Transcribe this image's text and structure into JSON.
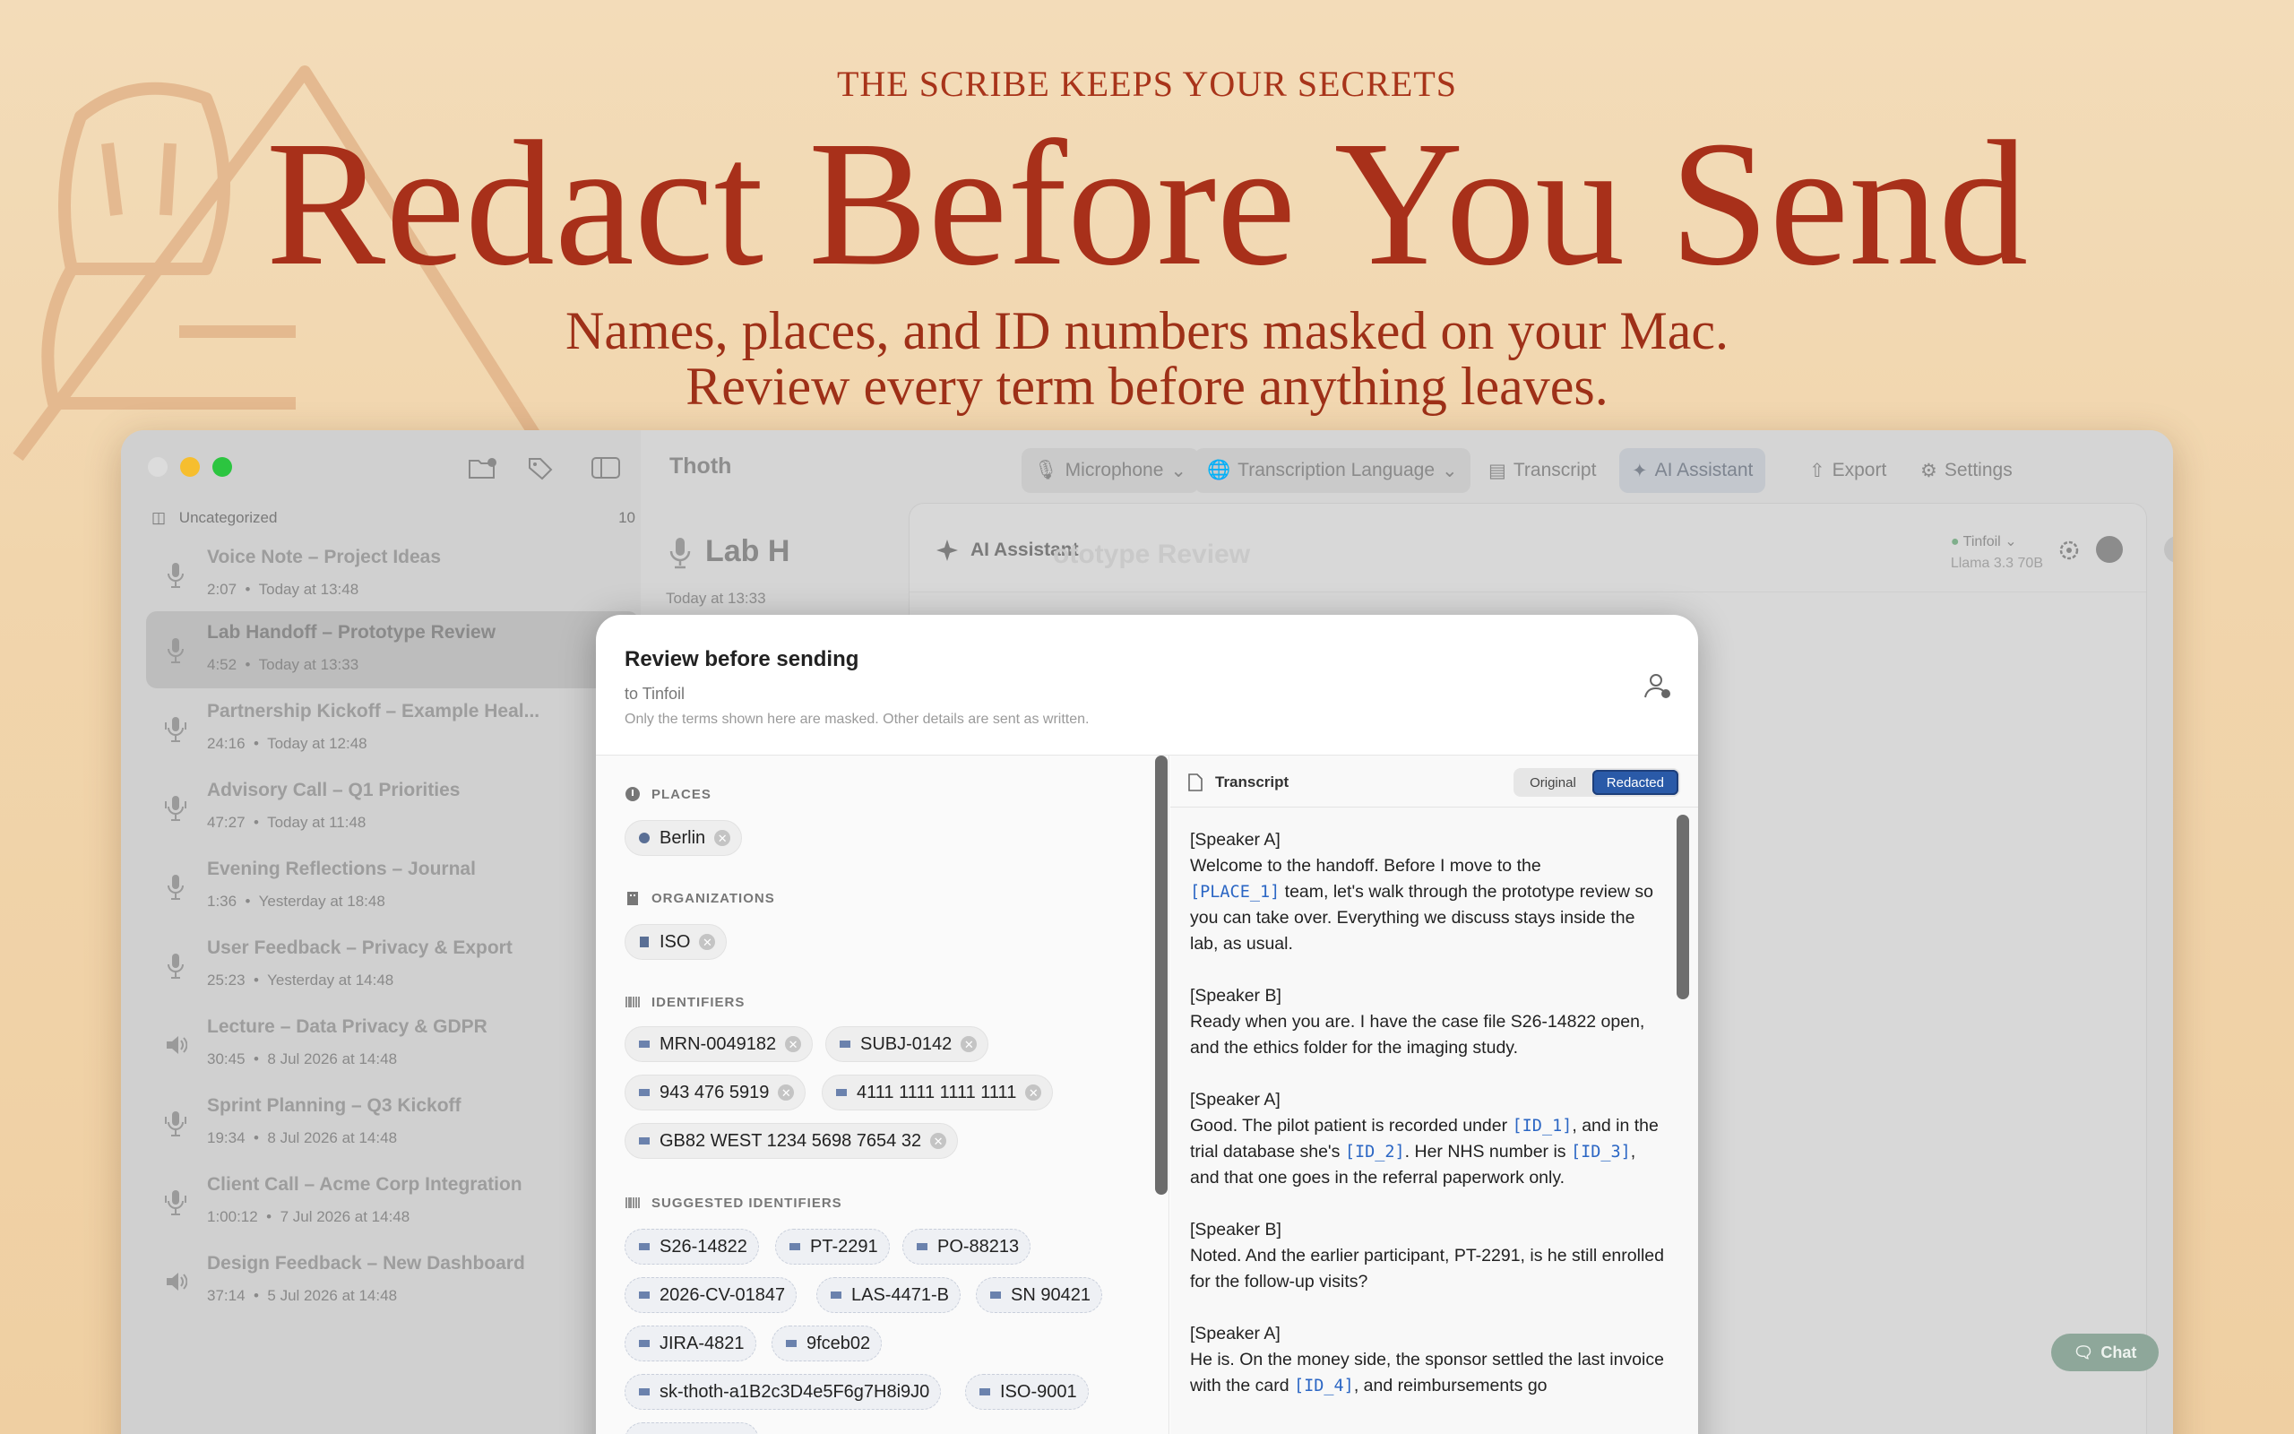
{
  "hero": {
    "tagline": "THE SCRIBE KEEPS YOUR SECRETS",
    "headline": "Redact Before You Send",
    "subline1": "Names, places, and ID numbers masked on your Mac.",
    "subline2": "Review every term before anything leaves."
  },
  "app": {
    "title": "Thoth",
    "toolbar": {
      "microphone": "Microphone",
      "language": "Transcription Language",
      "transcript": "Transcript",
      "ai_assistant": "AI Assistant",
      "export": "Export",
      "settings": "Settings"
    }
  },
  "sidebar": {
    "group": "Uncategorized",
    "group_count": "10",
    "items": [
      {
        "title": "Voice Note – Project Ideas",
        "duration": "2:07",
        "when": "Today at 13:48",
        "icon": "mic-icon"
      },
      {
        "title": "Lab Handoff – Prototype Review",
        "duration": "4:52",
        "when": "Today at 13:33",
        "icon": "mic-icon"
      },
      {
        "title": "Partnership Kickoff – Example Heal...",
        "duration": "24:16",
        "when": "Today at 12:48",
        "icon": "mic-waves-icon"
      },
      {
        "title": "Advisory Call – Q1 Priorities",
        "duration": "47:27",
        "when": "Today at 11:48",
        "icon": "mic-waves-icon"
      },
      {
        "title": "Evening Reflections – Journal",
        "duration": "1:36",
        "when": "Yesterday at 18:48",
        "icon": "mic-icon"
      },
      {
        "title": "User Feedback – Privacy & Export",
        "duration": "25:23",
        "when": "Yesterday at 14:48",
        "icon": "mic-icon"
      },
      {
        "title": "Lecture – Data Privacy & GDPR",
        "duration": "30:45",
        "when": "8 Jul 2026 at 14:48",
        "icon": "speaker-icon"
      },
      {
        "title": "Sprint Planning – Q3 Kickoff",
        "duration": "19:34",
        "when": "8 Jul 2026 at 14:48",
        "icon": "mic-waves-icon"
      },
      {
        "title": "Client Call – Acme Corp Integration",
        "duration": "1:00:12",
        "when": "7 Jul 2026 at 14:48",
        "icon": "mic-waves-icon"
      },
      {
        "title": "Design Feedback – New Dashboard",
        "duration": "37:14",
        "when": "5 Jul 2026 at 14:48",
        "icon": "speaker-icon"
      }
    ]
  },
  "note": {
    "title": "Lab H",
    "time": "Today at 13:33"
  },
  "ai_panel": {
    "title": "AI Assistant",
    "ghost_title": "ototype Review",
    "provider": "Tinfoil",
    "model": "Llama 3.3 70B",
    "chat_label": "Chat"
  },
  "review": {
    "title": "Review before sending",
    "to": "to Tinfoil",
    "note": "Only the terms shown here are masked. Other details are sent as written.",
    "sections": {
      "places": "PLACES",
      "organizations": "ORGANIZATIONS",
      "identifiers": "IDENTIFIERS",
      "suggested": "SUGGESTED IDENTIFIERS"
    },
    "places": [
      "Berlin"
    ],
    "organizations": [
      "ISO"
    ],
    "identifiers": [
      "MRN-0049182",
      "SUBJ-0142",
      "943 476 5919",
      "4111 1111 1111 1111",
      "GB82 WEST 1234 5698 7654 32"
    ],
    "suggested": [
      "S26-14822",
      "PT-2291",
      "PO-88213",
      "2026-CV-01847",
      "LAS-4471-B",
      "SN 90421",
      "JIRA-4821",
      "9fceb02",
      "sk-thoth-a1B2c3D4e5F6g7H8i9J0",
      "ISO-9001"
    ],
    "transcript_label": "Transcript",
    "toggle_original": "Original",
    "toggle_redacted": "Redacted",
    "toggle_selected": "Redacted",
    "transcript_lines": {
      "p1_speaker": "[Speaker A]",
      "p1_a": "Welcome to the handoff. Before I move to the",
      "p1_tok": "[PLACE_1]",
      "p1_b": " team, let's walk through the prototype review so you can take over. Everything we discuss stays inside the lab, as usual.",
      "p2_speaker": "[Speaker B]",
      "p2_a": "Ready when you are. I have the case file S26-14822 open, and the ethics folder for the imaging study.",
      "p3_speaker": "[Speaker A]",
      "p3_a": "Good. The pilot patient is recorded under ",
      "p3_tok1": "[ID_1]",
      "p3_b": ", and in the trial database she's ",
      "p3_tok2": "[ID_2]",
      "p3_c": ". Her NHS number is ",
      "p3_tok3": "[ID_3]",
      "p3_d": ", and that one goes in the referral paperwork only.",
      "p4_speaker": "[Speaker B]",
      "p4_a": "Noted. And the earlier participant, PT-2291, is he still enrolled for the follow-up visits?",
      "p5_speaker": "[Speaker A]",
      "p5_a": "He is. On the money side, the sponsor settled the last invoice with the card ",
      "p5_tok": "[ID_4]",
      "p5_b": ", and reimbursements go"
    }
  }
}
